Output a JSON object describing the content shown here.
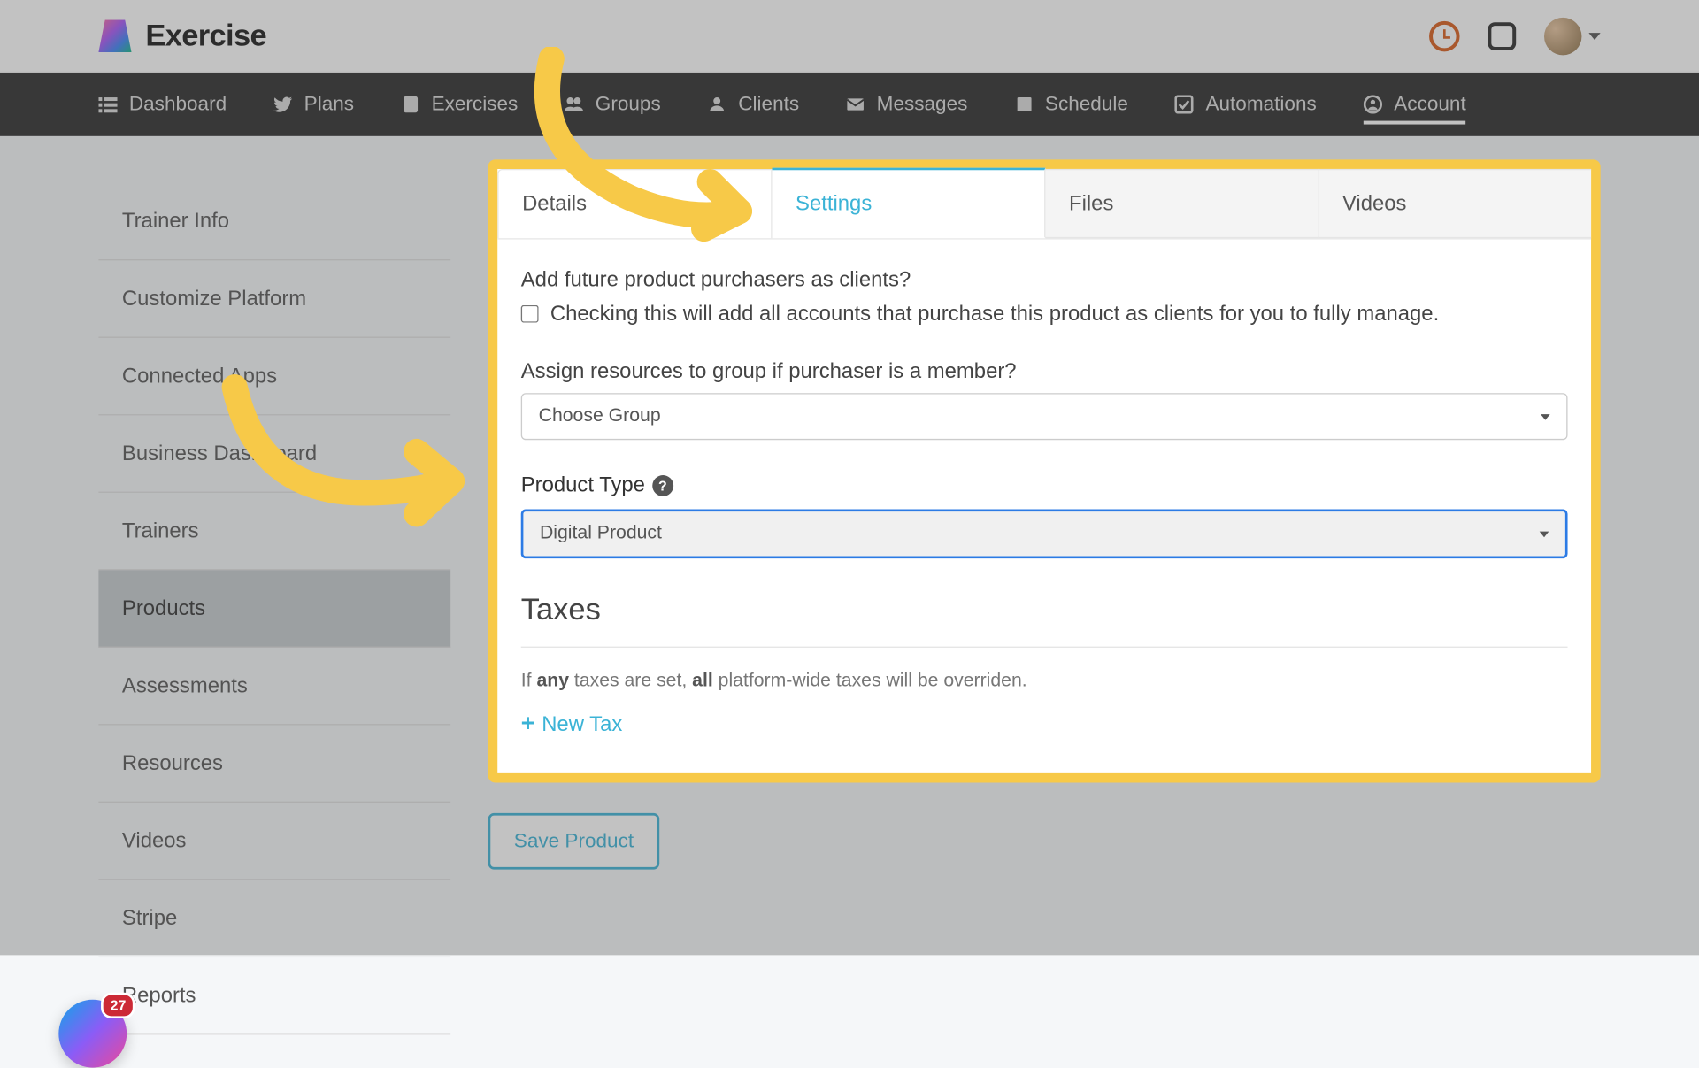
{
  "header": {
    "brand": "Exercise",
    "badge": "27"
  },
  "nav": {
    "items": [
      {
        "label": "Dashboard"
      },
      {
        "label": "Plans"
      },
      {
        "label": "Exercises"
      },
      {
        "label": "Groups"
      },
      {
        "label": "Clients"
      },
      {
        "label": "Messages"
      },
      {
        "label": "Schedule"
      },
      {
        "label": "Automations"
      },
      {
        "label": "Account"
      }
    ]
  },
  "sidebar": {
    "items": [
      {
        "label": "Trainer Info"
      },
      {
        "label": "Customize Platform"
      },
      {
        "label": "Connected Apps"
      },
      {
        "label": "Business Dashboard"
      },
      {
        "label": "Trainers"
      },
      {
        "label": "Products"
      },
      {
        "label": "Assessments"
      },
      {
        "label": "Resources"
      },
      {
        "label": "Videos"
      },
      {
        "label": "Stripe"
      },
      {
        "label": "Reports"
      }
    ]
  },
  "tabs": {
    "details": "Details",
    "settings": "Settings",
    "files": "Files",
    "videos": "Videos"
  },
  "panel": {
    "q1": "Add future product purchasers as clients?",
    "q1_help": "Checking this will add all accounts that purchase this product as clients for you to fully manage.",
    "q2": "Assign resources to group if purchaser is a member?",
    "group_select": "Choose Group",
    "product_type_label": "Product Type",
    "product_type_value": "Digital Product",
    "taxes_heading": "Taxes",
    "taxes_note_prefix": "If ",
    "taxes_note_any": "any",
    "taxes_note_mid": " taxes are set, ",
    "taxes_note_all": "all",
    "taxes_note_suffix": " platform-wide taxes will be overriden.",
    "new_tax": "New Tax",
    "save_btn": "Save Product"
  }
}
